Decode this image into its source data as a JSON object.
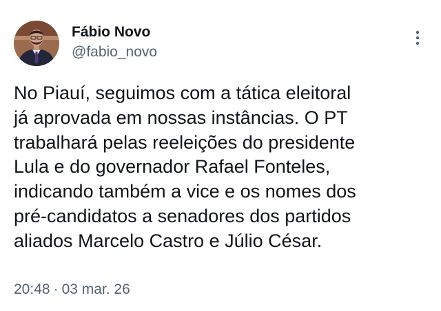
{
  "author": {
    "display_name": "Fábio Novo",
    "handle": "@fabio_novo"
  },
  "tweet": {
    "text": "No Piauí, seguimos com a tática eleitoral\njá aprovada em nossas instâncias. O PT\ntrabalhará pelas reeleições do presidente\nLula e do governador Rafael Fonteles,\nindicando também a vice e os nomes dos\npré-candidatos a senadores dos partidos\naliados Marcelo Castro e Júlio César.",
    "time": "20:48",
    "separator": "·",
    "date": "03 mar. 26"
  },
  "icons": {
    "more": "more-vertical-icon",
    "avatar": "profile-photo"
  },
  "colors": {
    "text_primary": "#0f1419",
    "text_secondary": "#536471",
    "background": "#ffffff"
  }
}
